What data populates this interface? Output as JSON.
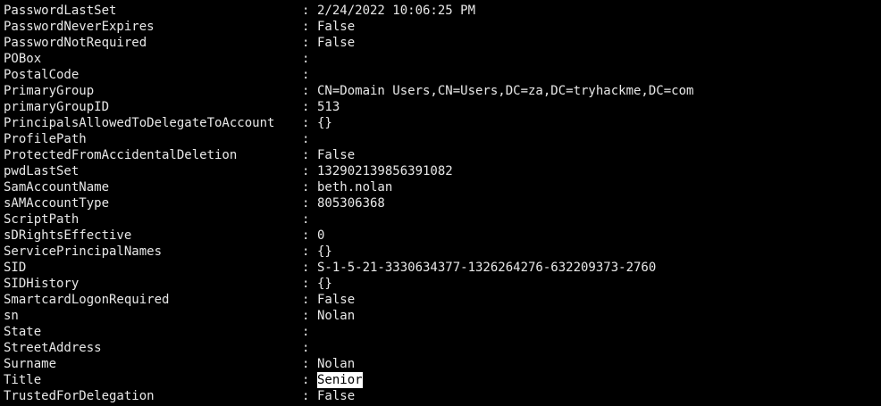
{
  "terminal": {
    "separator": ":",
    "rows": [
      {
        "key": "PasswordLastSet",
        "value": "2/24/2022 10:06:25 PM"
      },
      {
        "key": "PasswordNeverExpires",
        "value": "False"
      },
      {
        "key": "PasswordNotRequired",
        "value": "False"
      },
      {
        "key": "POBox",
        "value": ""
      },
      {
        "key": "PostalCode",
        "value": ""
      },
      {
        "key": "PrimaryGroup",
        "value": "CN=Domain Users,CN=Users,DC=za,DC=tryhackme,DC=com"
      },
      {
        "key": "primaryGroupID",
        "value": "513"
      },
      {
        "key": "PrincipalsAllowedToDelegateToAccount",
        "value": "{}"
      },
      {
        "key": "ProfilePath",
        "value": ""
      },
      {
        "key": "ProtectedFromAccidentalDeletion",
        "value": "False"
      },
      {
        "key": "pwdLastSet",
        "value": "132902139856391082"
      },
      {
        "key": "SamAccountName",
        "value": "beth.nolan"
      },
      {
        "key": "sAMAccountType",
        "value": "805306368"
      },
      {
        "key": "ScriptPath",
        "value": ""
      },
      {
        "key": "sDRightsEffective",
        "value": "0"
      },
      {
        "key": "ServicePrincipalNames",
        "value": "{}"
      },
      {
        "key": "SID",
        "value": "S-1-5-21-3330634377-1326264276-632209373-2760"
      },
      {
        "key": "SIDHistory",
        "value": "{}"
      },
      {
        "key": "SmartcardLogonRequired",
        "value": "False"
      },
      {
        "key": "sn",
        "value": "Nolan"
      },
      {
        "key": "State",
        "value": ""
      },
      {
        "key": "StreetAddress",
        "value": ""
      },
      {
        "key": "Surname",
        "value": "Nolan"
      },
      {
        "key": "Title",
        "value": "Senior",
        "selected": true
      },
      {
        "key": "TrustedForDelegation",
        "value": "False"
      }
    ]
  },
  "colors": {
    "background": "#000000",
    "text": "#e8e8e8",
    "selection_bg": "#ffffff",
    "selection_fg": "#000000"
  }
}
